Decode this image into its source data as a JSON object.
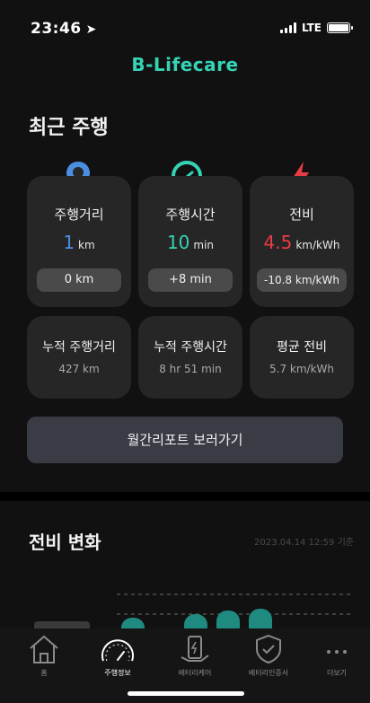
{
  "status": {
    "time": "23:46",
    "network": "LTE"
  },
  "app": {
    "brand": "B-Lifecare"
  },
  "recent_driving": {
    "title": "최근 주행",
    "stats": [
      {
        "label": "주행거리",
        "value": "1",
        "unit": "km",
        "delta": "0 km",
        "color": "#4a8fe0",
        "icon": "location-pin-icon"
      },
      {
        "label": "주행시간",
        "value": "10",
        "unit": "min",
        "delta": "+8 min",
        "color": "#35d3b4",
        "icon": "speedometer-icon"
      },
      {
        "label": "전비",
        "value": "4.5",
        "unit": "km/kWh",
        "delta": "-10.8 km/kWh",
        "color": "#e83c45",
        "icon": "lightning-icon"
      }
    ],
    "cumulative": [
      {
        "label": "누적 주행거리",
        "value": "427 km"
      },
      {
        "label": "누적 주행시간",
        "value": "8 hr 51 min"
      },
      {
        "label": "평균 전비",
        "value": "5.7 km/kWh"
      }
    ],
    "report_button": "월간리포트 보러가기"
  },
  "efficiency_change": {
    "title": "전비 변화",
    "timestamp": "2023.04.14 12:59 기준"
  },
  "tabs": [
    {
      "label": "홈",
      "icon": "home-icon"
    },
    {
      "label": "주행정보",
      "icon": "speedometer-icon",
      "active": true
    },
    {
      "label": "배터리케어",
      "icon": "battery-care-icon"
    },
    {
      "label": "배터리인증서",
      "icon": "shield-check-icon"
    },
    {
      "label": "더보기",
      "icon": "more-icon"
    }
  ]
}
